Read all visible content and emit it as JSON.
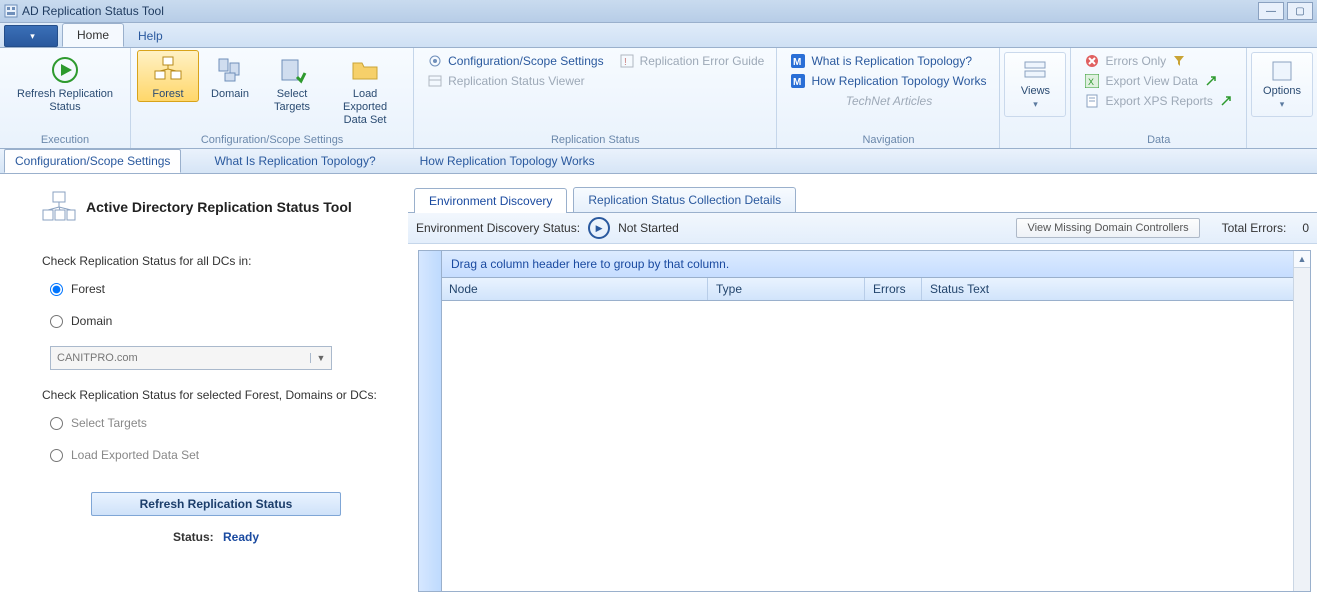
{
  "window": {
    "title": "AD Replication Status Tool"
  },
  "menu": {
    "home": "Home",
    "help": "Help"
  },
  "ribbon": {
    "execution": {
      "refresh": "Refresh Replication\nStatus",
      "group": "Execution"
    },
    "scope": {
      "forest": "Forest",
      "domain": "Domain",
      "select_targets": "Select\nTargets",
      "load_exported": "Load Exported\nData Set",
      "group": "Configuration/Scope Settings"
    },
    "repstatus": {
      "config_settings": "Configuration/Scope Settings",
      "status_viewer": "Replication Status Viewer",
      "error_guide": "Replication Error Guide",
      "group": "Replication Status"
    },
    "nav": {
      "what_is": "What is Replication Topology?",
      "how_works": "How Replication Topology Works",
      "technet": "TechNet Articles",
      "group": "Navigation"
    },
    "views": {
      "label": "Views"
    },
    "data": {
      "errors_only": "Errors Only",
      "export_view": "Export View Data",
      "export_xps": "Export XPS Reports",
      "group": "Data"
    },
    "options": {
      "label": "Options"
    }
  },
  "subtabs": {
    "config": "Configuration/Scope Settings",
    "what_is": "What Is Replication Topology?",
    "how_works": "How Replication Topology Works"
  },
  "left": {
    "title": "Active Directory Replication Status Tool",
    "check_all_label": "Check Replication Status for all DCs in:",
    "radio_forest": "Forest",
    "radio_domain": "Domain",
    "combo_value": "CANITPRO.com",
    "check_selected_label": "Check Replication Status for selected Forest, Domains or DCs:",
    "radio_select_targets": "Select Targets",
    "radio_load_exported": "Load Exported Data Set",
    "refresh_button": "Refresh Replication Status",
    "status_label": "Status:",
    "status_value": "Ready"
  },
  "right": {
    "tab_env": "Environment Discovery",
    "tab_coll": "Replication Status Collection Details",
    "env_status_label": "Environment Discovery Status:",
    "env_status_value": "Not Started",
    "view_missing_btn": "View Missing Domain Controllers",
    "total_errors_label": "Total Errors:",
    "total_errors_value": "0",
    "group_hint": "Drag a column header here to group by that column.",
    "cols": {
      "node": "Node",
      "type": "Type",
      "errors": "Errors",
      "status_text": "Status Text"
    }
  }
}
